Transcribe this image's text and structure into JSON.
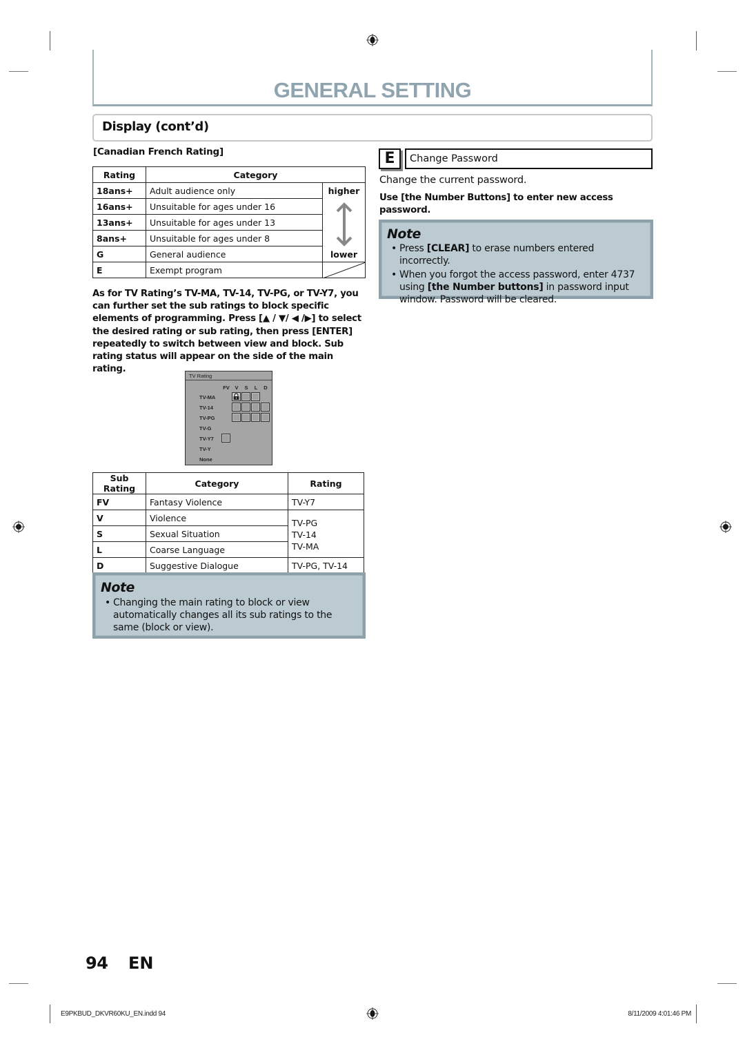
{
  "header": {
    "title": "GENERAL SETTING",
    "section": "Display (cont’d)",
    "title_color": "#8fa4ae"
  },
  "canadian_french": {
    "heading": "[Canadian French Rating]",
    "columns": [
      "Rating",
      "Category"
    ],
    "rows": [
      {
        "rating": "18ans+",
        "category": "Adult audience only"
      },
      {
        "rating": "16ans+",
        "category": "Unsuitable for ages under 16"
      },
      {
        "rating": "13ans+",
        "category": "Unsuitable for ages under 13"
      },
      {
        "rating": "8ans+",
        "category": "Unsuitable for ages under 8"
      },
      {
        "rating": "G",
        "category": "General audience"
      },
      {
        "rating": "E",
        "category": "Exempt program"
      }
    ],
    "scale_high": "higher",
    "scale_low": "lower"
  },
  "instructions": "As for TV Rating’s TV-MA, TV-14, TV-PG, or TV-Y7, you can further set the sub ratings to block specific elements of programming. Press [▲ / ▼/ ◀ /▶] to select the desired rating or sub rating, then press [ENTER] repeatedly to switch between view and block. Sub rating status will appear on the side of the main rating.",
  "tv_rating_screen": {
    "title": "TV Rating",
    "columns": [
      "FV",
      "V",
      "S",
      "L",
      "D"
    ],
    "rows": [
      "TV-MA",
      "TV-14",
      "TV-PG",
      "TV-G",
      "TV-Y7",
      "TV-Y",
      "None"
    ],
    "cells": {
      "TV-MA": [
        "V",
        "S",
        "L"
      ],
      "TV-14": [
        "V",
        "S",
        "L",
        "D"
      ],
      "TV-PG": [
        "V",
        "S",
        "L",
        "D"
      ],
      "TV-Y7": [
        "FV"
      ]
    },
    "locked": {
      "row": "TV-MA",
      "column": "V"
    }
  },
  "sub_rating_table": {
    "columns": [
      "Sub Rating",
      "Category",
      "Rating"
    ],
    "rows": [
      {
        "sub": "FV",
        "category": "Fantasy Violence",
        "rating": "TV-Y7"
      },
      {
        "sub": "V",
        "category": "Violence"
      },
      {
        "sub": "S",
        "category": "Sexual Situation"
      },
      {
        "sub": "L",
        "category": "Coarse Language"
      },
      {
        "sub": "D",
        "category": "Suggestive Dialogue",
        "rating": "TV-PG, TV-14"
      }
    ],
    "merged_rating": [
      "TV-PG",
      "TV-14",
      "TV-MA"
    ]
  },
  "note_left": {
    "title": "Note",
    "items": [
      "Changing the main rating to block or view automatically changes all its sub ratings to the same (block or view)."
    ]
  },
  "section_e": {
    "badge": "E",
    "label": "Change Password",
    "description": "Change the current password.",
    "instruction": "Use [the Number Buttons] to enter new access password."
  },
  "note_right": {
    "title": "Note",
    "item1_pre": "Press ",
    "item1_bold": "[CLEAR]",
    "item1_post": " to erase numbers entered incorrectly.",
    "item2_pre": "When you forgot the access password, enter 4737 using ",
    "item2_bold": "[the Number buttons]",
    "item2_post": " in password input window. Password will be cleared."
  },
  "page": {
    "number": "94",
    "lang": "EN"
  },
  "footer": {
    "file": "E9PKBUD_DKVR60KU_EN.indd   94",
    "timestamp": "8/11/2009   4:01:46 PM"
  },
  "bullet": "•"
}
